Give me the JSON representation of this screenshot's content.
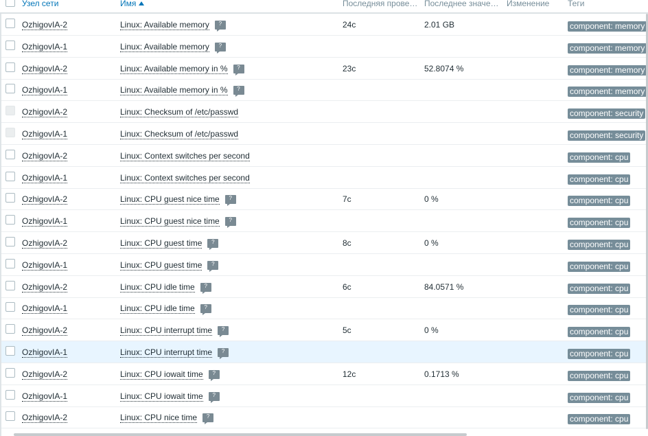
{
  "columns": {
    "host": "Узел сети",
    "name": "Имя",
    "last_check": "Последняя прове…",
    "last_value": "Последнее значе…",
    "change": "Изменение",
    "tags": "Теги"
  },
  "rows": [
    {
      "host": "OzhigovIA-2",
      "name": "Linux: Available memory",
      "info": true,
      "last_check": "24с",
      "last_value": "2.01 GB",
      "change": "",
      "tag": "component: memory",
      "disabled": false
    },
    {
      "host": "OzhigovIA-1",
      "name": "Linux: Available memory",
      "info": true,
      "last_check": "",
      "last_value": "",
      "change": "",
      "tag": "component: memory",
      "disabled": false
    },
    {
      "host": "OzhigovIA-2",
      "name": "Linux: Available memory in %",
      "info": true,
      "last_check": "23с",
      "last_value": "52.8074 %",
      "change": "",
      "tag": "component: memory",
      "disabled": false
    },
    {
      "host": "OzhigovIA-1",
      "name": "Linux: Available memory in %",
      "info": true,
      "last_check": "",
      "last_value": "",
      "change": "",
      "tag": "component: memory",
      "disabled": false
    },
    {
      "host": "OzhigovIA-2",
      "name": "Linux: Checksum of /etc/passwd",
      "info": false,
      "last_check": "",
      "last_value": "",
      "change": "",
      "tag": "component: security",
      "disabled": true
    },
    {
      "host": "OzhigovIA-1",
      "name": "Linux: Checksum of /etc/passwd",
      "info": false,
      "last_check": "",
      "last_value": "",
      "change": "",
      "tag": "component: security",
      "disabled": true
    },
    {
      "host": "OzhigovIA-2",
      "name": "Linux: Context switches per second",
      "info": false,
      "last_check": "",
      "last_value": "",
      "change": "",
      "tag": "component: cpu",
      "disabled": false
    },
    {
      "host": "OzhigovIA-1",
      "name": "Linux: Context switches per second",
      "info": false,
      "last_check": "",
      "last_value": "",
      "change": "",
      "tag": "component: cpu",
      "disabled": false
    },
    {
      "host": "OzhigovIA-2",
      "name": "Linux: CPU guest nice time",
      "info": true,
      "last_check": "7с",
      "last_value": "0 %",
      "change": "",
      "tag": "component: cpu",
      "disabled": false
    },
    {
      "host": "OzhigovIA-1",
      "name": "Linux: CPU guest nice time",
      "info": true,
      "last_check": "",
      "last_value": "",
      "change": "",
      "tag": "component: cpu",
      "disabled": false
    },
    {
      "host": "OzhigovIA-2",
      "name": "Linux: CPU guest time",
      "info": true,
      "last_check": "8с",
      "last_value": "0 %",
      "change": "",
      "tag": "component: cpu",
      "disabled": false
    },
    {
      "host": "OzhigovIA-1",
      "name": "Linux: CPU guest time",
      "info": true,
      "last_check": "",
      "last_value": "",
      "change": "",
      "tag": "component: cpu",
      "disabled": false
    },
    {
      "host": "OzhigovIA-2",
      "name": "Linux: CPU idle time",
      "info": true,
      "last_check": "6с",
      "last_value": "84.0571 %",
      "change": "",
      "tag": "component: cpu",
      "disabled": false
    },
    {
      "host": "OzhigovIA-1",
      "name": "Linux: CPU idle time",
      "info": true,
      "last_check": "",
      "last_value": "",
      "change": "",
      "tag": "component: cpu",
      "disabled": false
    },
    {
      "host": "OzhigovIA-2",
      "name": "Linux: CPU interrupt time",
      "info": true,
      "last_check": "5с",
      "last_value": "0 %",
      "change": "",
      "tag": "component: cpu",
      "disabled": false
    },
    {
      "host": "OzhigovIA-1",
      "name": "Linux: CPU interrupt time",
      "info": true,
      "last_check": "",
      "last_value": "",
      "change": "",
      "tag": "component: cpu",
      "disabled": false,
      "highlighted": true
    },
    {
      "host": "OzhigovIA-2",
      "name": "Linux: CPU iowait time",
      "info": true,
      "last_check": "12с",
      "last_value": "0.1713 %",
      "change": "",
      "tag": "component: cpu",
      "disabled": false
    },
    {
      "host": "OzhigovIA-1",
      "name": "Linux: CPU iowait time",
      "info": true,
      "last_check": "",
      "last_value": "",
      "change": "",
      "tag": "component: cpu",
      "disabled": false
    },
    {
      "host": "OzhigovIA-2",
      "name": "Linux: CPU nice time",
      "info": true,
      "last_check": "",
      "last_value": "",
      "change": "",
      "tag": "component: cpu",
      "disabled": false
    }
  ],
  "info_icon_symbol": "?",
  "icons": {
    "info": "info-hint-icon",
    "sort": "sort-ascending-icon"
  },
  "colors": {
    "link": "#0275b8",
    "tag_bg": "#768d99",
    "row_highlight": "#e8f5ff",
    "info_bg": "#7a8a93"
  }
}
